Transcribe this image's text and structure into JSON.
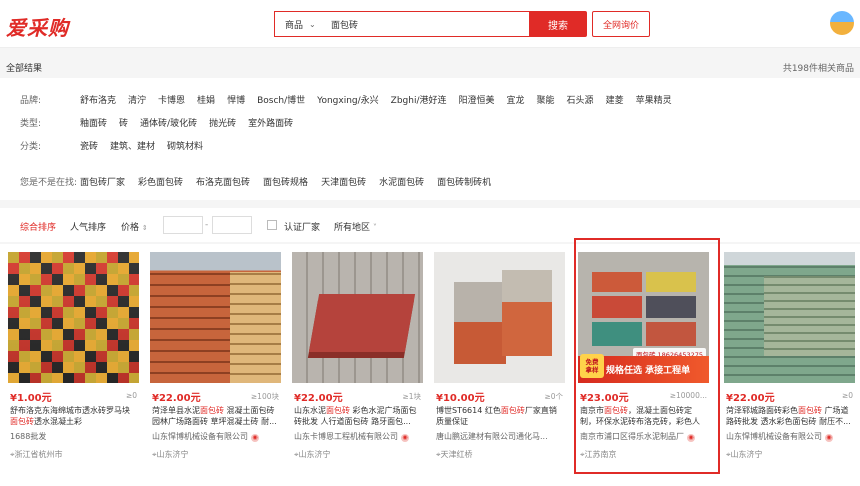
{
  "header": {
    "logo": "爱采购",
    "search_type": "商品",
    "search_value": "面包砖",
    "search_button": "搜索",
    "inquiry_button": "全网询价"
  },
  "results": {
    "all_label": "全部结果",
    "count_text": "共198件相关商品"
  },
  "filters": {
    "brand_label": "品牌:",
    "brands": [
      "舒布洛克",
      "清泞",
      "卡博恩",
      "桂娟",
      "悍博",
      "Bosch/博世",
      "Yongxing/永兴",
      "Zbghi/港好连",
      "阳澄恒美",
      "宜龙",
      "聚能",
      "石头源",
      "建菱",
      "苹果精灵"
    ],
    "type_label": "类型:",
    "types": [
      "釉面砖",
      "砖",
      "通体砖/玻化砖",
      "抛光砖",
      "室外路面砖"
    ],
    "category_label": "分类:",
    "categories": [
      "瓷砖",
      "建筑、建材",
      "砌筑材料"
    ],
    "suggest_label": "您是不是在找:",
    "suggestions": [
      "面包砖厂家",
      "彩色面包砖",
      "布洛克面包砖",
      "面包砖规格",
      "天津面包砖",
      "水泥面包砖",
      "面包砖制砖机"
    ]
  },
  "sortbar": {
    "comprehensive": "综合排序",
    "popularity": "人气排序",
    "price": "价格",
    "price_arrow": "⇕",
    "dash": "-",
    "certified": "认证厂家",
    "region": "所有地区",
    "region_arrow": "˅"
  },
  "products": [
    {
      "price": "¥1.00元",
      "sold": "≥0",
      "title_a": "舒布洛克东海绵城市透水砖罗马块",
      "title_em": "面包砖",
      "title_b": "透水混凝土彩",
      "meta": "1688批发",
      "loc": "浙江省杭州市"
    },
    {
      "price": "¥22.00元",
      "sold": "≥100块",
      "title_a": "菏泽单县水泥",
      "title_em": "面包砖",
      "title_b": " 混凝土面包砖园林广场路面砖 草坪混凝土砖 耐...",
      "meta": "山东悍博机械设备有限公司",
      "loc": "山东济宁"
    },
    {
      "price": "¥22.00元",
      "sold": "≥1块",
      "title_a": "山东水泥",
      "title_em": "面包砖",
      "title_b": " 彩色水泥广场面包砖批发 人行道面包砖 路牙面包...",
      "meta": "山东卡博恩工程机械有限公司",
      "loc": "山东济宁"
    },
    {
      "price": "¥10.00元",
      "sold": "≥0个",
      "title_a": "博世ST6614 红色",
      "title_em": "面包砖",
      "title_b": "厂家直销 质量保证",
      "meta": "唐山鹏远建材有限公司通化马...",
      "loc": "天津红桥"
    },
    {
      "price": "¥23.00元",
      "sold": "≥10000...",
      "title_a": "南京市",
      "title_em": "面包砖",
      "title_b": "，混凝土面包砖定制，环保水泥砖布洛克砖，彩色人行道面",
      "meta": "南京市浦口区得乐水泥制品厂",
      "loc": "江苏南京",
      "promo_tag_top": "免费",
      "promo_tag_bottom": "拿样",
      "promo_text": "规格任选 承接工程单",
      "promo_phone": "面包砖 18626453275"
    },
    {
      "price": "¥22.00元",
      "sold": "≥0",
      "title_a": "菏泽郓城路面砖彩色",
      "title_em": "面包砖",
      "title_b": " 广场道路砖批发 透水彩色面包砖 耐压不...",
      "meta": "山东悍博机械设备有限公司",
      "loc": "山东济宁"
    }
  ]
}
